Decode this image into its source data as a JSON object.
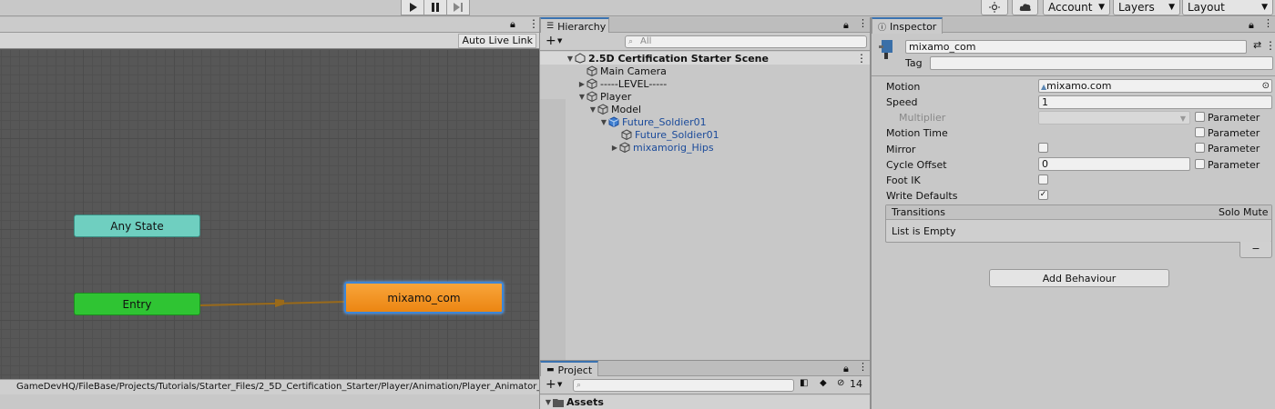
{
  "toolbar": {
    "play_icon": "play-icon",
    "pause_icon": "pause-icon",
    "step_icon": "step-icon",
    "account_label": "Account",
    "layers_label": "Layers",
    "layout_label": "Layout"
  },
  "animator": {
    "auto_live_link": "Auto Live Link",
    "states": {
      "any_state": "Any State",
      "entry": "Entry",
      "default_state": "mixamo_com"
    },
    "colors": {
      "any_state": "#6fcfc0",
      "entry": "#2fc433",
      "default_state": "#f0901a",
      "transition": "#9a6a1a"
    },
    "path": "GameDevHQ/FileBase/Projects/Tutorials/Starter_Files/2_5D_Certification_Starter/Player/Animation/Player_Animator_Controller.controller"
  },
  "hierarchy": {
    "tab_label": "Hierarchy",
    "search_placeholder": "All",
    "scene_name": "2.5D Certification Starter Scene",
    "items": [
      {
        "label": "Main Camera"
      },
      {
        "label": "-----LEVEL-----"
      },
      {
        "label": "Player"
      },
      {
        "label": "Model"
      },
      {
        "label": "Future_Soldier01"
      },
      {
        "label": "Future_Soldier01"
      },
      {
        "label": "mixamorig_Hips"
      }
    ]
  },
  "project": {
    "tab_label": "Project",
    "assets_label": "Assets",
    "hidden_count": "14"
  },
  "inspector": {
    "tab_label": "Inspector",
    "name": "mixamo_com",
    "tag_label": "Tag",
    "motion_label": "Motion",
    "motion_value": "mixamo.com",
    "speed_label": "Speed",
    "speed_value": "1",
    "multiplier_label": "Multiplier",
    "motion_time_label": "Motion Time",
    "mirror_label": "Mirror",
    "cycle_offset_label": "Cycle Offset",
    "cycle_offset_value": "0",
    "foot_ik_label": "Foot IK",
    "write_defaults_label": "Write Defaults",
    "parameter_label": "Parameter",
    "transitions_label": "Transitions",
    "solo_label": "Solo",
    "mute_label": "Mute",
    "list_empty": "List is Empty",
    "minus_label": "−",
    "add_behaviour": "Add Behaviour"
  }
}
